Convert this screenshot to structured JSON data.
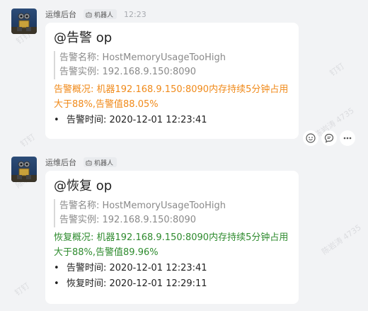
{
  "watermarks": [
    "钉钉",
    "陈岩涛 4735",
    "钉钉",
    "陈岩涛",
    "钉钉",
    "陈岩涛 4735",
    "钉钉"
  ],
  "messages": [
    {
      "sender": "运维后台",
      "tag": "机器人",
      "time": "12:23",
      "title": "@告警 op",
      "quote": [
        "告警名称: HostMemoryUsageTooHigh",
        "告警实例: 192.168.9.150:8090"
      ],
      "summary": "告警概况: 机器192.168.9.150:8090内存持续5分钟占用大于88%,告警值88.05%",
      "bullets": [
        "告警时间: 2020-12-01 12:23:41"
      ]
    },
    {
      "sender": "运维后台",
      "tag": "机器人",
      "time": "",
      "title": "@恢复 op",
      "quote": [
        "告警名称: HostMemoryUsageTooHigh",
        "告警实例: 192.168.9.150:8090"
      ],
      "summary": "恢复概况: 机器192.168.9.150:8090内存持续5分钟占用大于88%,告警值89.96%",
      "bullets": [
        "告警时间: 2020-12-01 12:23:41",
        "恢复时间: 2020-12-01 12:29:11"
      ]
    }
  ],
  "action_icons": [
    "emoji-icon",
    "comment-icon",
    "more-icon"
  ],
  "colors": {
    "alert": "#f08a1a",
    "recover": "#2e8b2e",
    "background": "#f2f3f5"
  }
}
